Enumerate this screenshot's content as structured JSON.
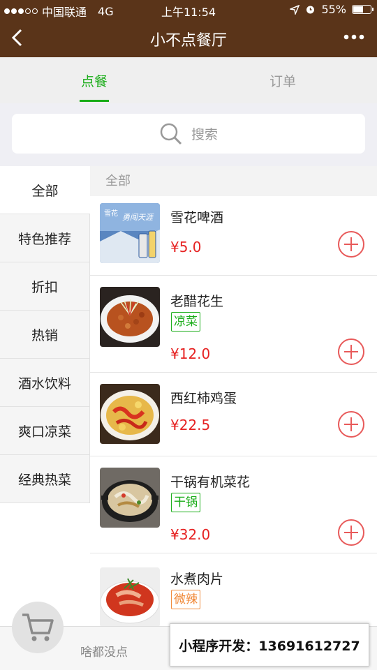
{
  "status_bar": {
    "carrier": "中国联通",
    "network": "4G",
    "time": "上午11:54",
    "battery": "55%"
  },
  "nav": {
    "title": "小不点餐厅"
  },
  "tabs": [
    {
      "label": "点餐",
      "active": true
    },
    {
      "label": "订单",
      "active": false
    }
  ],
  "search": {
    "placeholder": "搜索"
  },
  "categories": [
    {
      "label": "全部",
      "active": true
    },
    {
      "label": "特色推荐",
      "active": false
    },
    {
      "label": "折扣",
      "active": false
    },
    {
      "label": "热销",
      "active": false
    },
    {
      "label": "酒水饮料",
      "active": false
    },
    {
      "label": "爽口凉菜",
      "active": false
    },
    {
      "label": "经典热菜",
      "active": false
    }
  ],
  "section_title": "全部",
  "items": [
    {
      "name": "雪花啤酒",
      "tag": "",
      "price": "¥5.0"
    },
    {
      "name": "老醋花生",
      "tag": "凉菜",
      "price": "¥12.0"
    },
    {
      "name": "西红柿鸡蛋",
      "tag": "",
      "price": "¥22.5"
    },
    {
      "name": "干锅有机菜花",
      "tag": "干锅",
      "price": "¥32.0"
    },
    {
      "name": "水煮肉片",
      "tag": "微辣",
      "price": ""
    }
  ],
  "beer_label": {
    "line1": "雪花",
    "line2": "勇闯天涯"
  },
  "cart": {
    "empty_text": "啥都没点"
  },
  "promo": {
    "text": "小程序开发：13691612727"
  },
  "colors": {
    "header_bg": "#5a3419",
    "accent_green": "#1aad19",
    "price_red": "#e62222",
    "tag_orange": "#f08a3a"
  }
}
